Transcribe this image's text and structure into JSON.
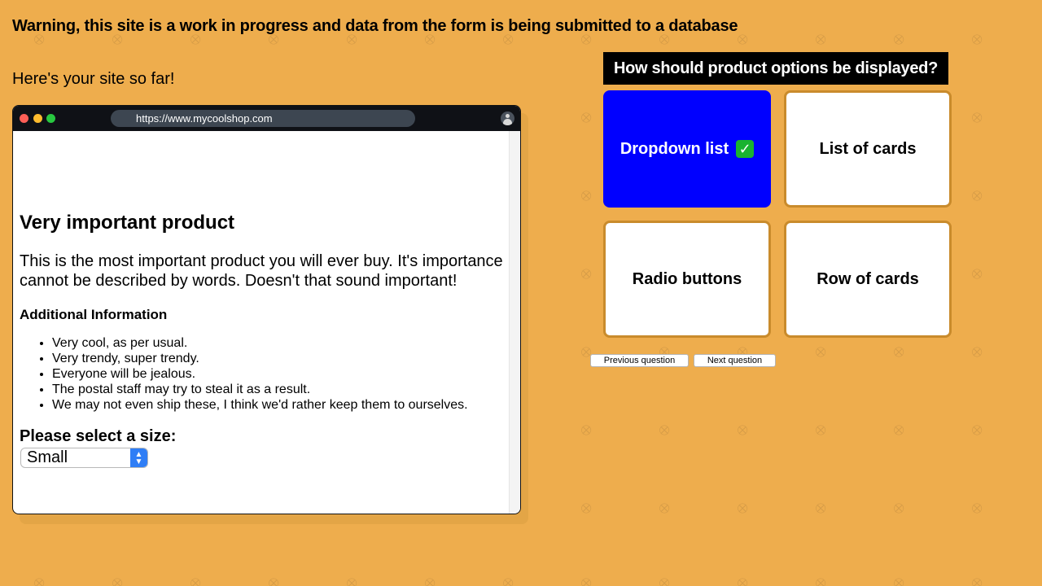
{
  "warning": "Warning, this site is a work in progress and data from the form is being submitted to a database",
  "intro": "Here's your site so far!",
  "browser": {
    "url": "https://www.mycoolshop.com",
    "product": {
      "title": "Very important product",
      "description": "This is the most important product you will ever buy. It's importance cannot be described by words. Doesn't that sound important!",
      "info_heading": "Additional Information",
      "info_items": [
        "Very cool, as per usual.",
        "Very trendy, super trendy.",
        "Everyone will be jealous.",
        "The postal staff may try to steal it as a result.",
        "We may not even ship these, I think we'd rather keep them to ourselves."
      ],
      "size_label": "Please select a size:",
      "size_value": "Small"
    }
  },
  "question": {
    "title": "How should product options be displayed?",
    "options": [
      {
        "label": "Dropdown list",
        "selected": true
      },
      {
        "label": "List of cards",
        "selected": false
      },
      {
        "label": "Radio buttons",
        "selected": false
      },
      {
        "label": "Row of cards",
        "selected": false
      }
    ],
    "check_icon": "check-mark-icon",
    "prev_label": "Previous question",
    "next_label": "Next question"
  },
  "colors": {
    "background": "#eead4d",
    "selected_option": "#0000ff",
    "option_border": "#c98b2c",
    "question_bg": "#000000"
  }
}
